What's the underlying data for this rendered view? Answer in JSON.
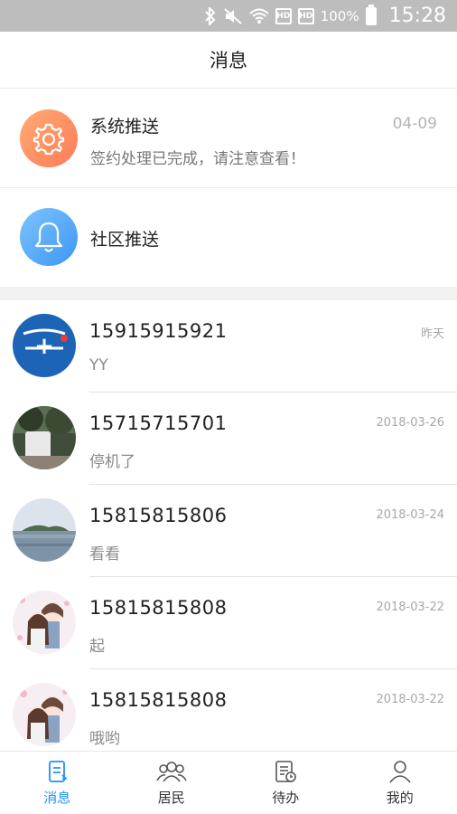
{
  "status_bar": {
    "battery": "100%",
    "time": "15:28",
    "sim1": "HD",
    "sim2": "HD"
  },
  "header": {
    "title": "消息"
  },
  "system_push": {
    "name": "系统推送",
    "message": "签约处理已完成，请注意查看！",
    "date": "04-09",
    "icon": "gear-icon"
  },
  "community_push": {
    "name": "社区推送",
    "icon": "bell-icon"
  },
  "conversations": [
    {
      "phone": "15915915921",
      "preview": "YY",
      "date": "昨天",
      "avatar": "logo-avatar"
    },
    {
      "phone": "15715715701",
      "preview": "停机了",
      "date": "2018-03-26",
      "avatar": "photo-avatar"
    },
    {
      "phone": "15815815806",
      "preview": "看看",
      "date": "2018-03-24",
      "avatar": "lake-avatar"
    },
    {
      "phone": "15815815808",
      "preview": "起",
      "date": "2018-03-22",
      "avatar": "anime-avatar"
    },
    {
      "phone": "15815815808",
      "preview": "哦哟",
      "date": "2018-03-22",
      "avatar": "anime-avatar"
    }
  ],
  "tabbar": {
    "tabs": [
      {
        "label": "消息",
        "icon": "message-icon",
        "active": true
      },
      {
        "label": "居民",
        "icon": "residents-icon",
        "active": false
      },
      {
        "label": "待办",
        "icon": "todo-icon",
        "active": false
      },
      {
        "label": "我的",
        "icon": "profile-icon",
        "active": false
      }
    ],
    "active_color": "#1e90ff"
  },
  "colors": {
    "system_push_gradient": [
      "#ffab75",
      "#fd7b57"
    ],
    "community_push_gradient": [
      "#7cc4ff",
      "#3d96f2"
    ]
  }
}
